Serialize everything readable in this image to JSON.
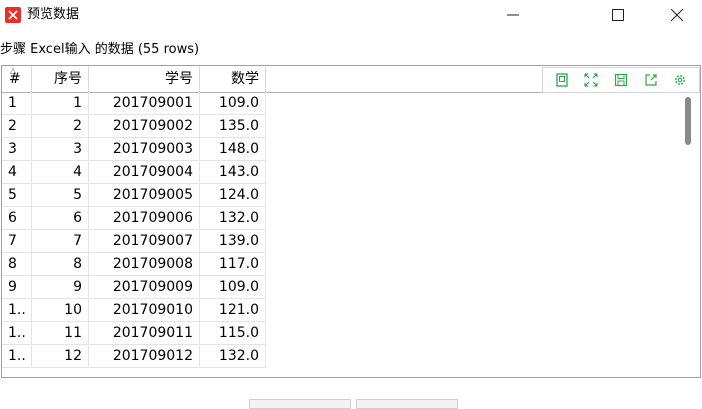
{
  "window": {
    "title": "预览数据",
    "app_icon": "app-logo-icon",
    "accent": "#e8302a",
    "controls": [
      "minimize-icon",
      "maximize-icon",
      "close-icon"
    ]
  },
  "subtitle": "步骤 Excel输入 的数据 (55 rows)",
  "table": {
    "columns": [
      "#",
      "序号",
      "学号",
      "数学"
    ],
    "rows": [
      [
        "1",
        "1",
        "201709001",
        "109.0"
      ],
      [
        "2",
        "2",
        "201709002",
        "135.0"
      ],
      [
        "3",
        "3",
        "201709003",
        "148.0"
      ],
      [
        "4",
        "4",
        "201709004",
        "143.0"
      ],
      [
        "5",
        "5",
        "201709005",
        "124.0"
      ],
      [
        "6",
        "6",
        "201709006",
        "132.0"
      ],
      [
        "7",
        "7",
        "201709007",
        "139.0"
      ],
      [
        "8",
        "8",
        "201709008",
        "117.0"
      ],
      [
        "9",
        "9",
        "201709009",
        "109.0"
      ],
      [
        "1..",
        "10",
        "201709010",
        "121.0"
      ],
      [
        "1..",
        "11",
        "201709011",
        "115.0"
      ],
      [
        "1..",
        "12",
        "201709012",
        "132.0"
      ]
    ]
  },
  "toolbar": {
    "accent": "#2ea84a",
    "tools": [
      "preview-icon",
      "expand-icon",
      "save-icon",
      "export-icon",
      "settings-icon"
    ]
  }
}
